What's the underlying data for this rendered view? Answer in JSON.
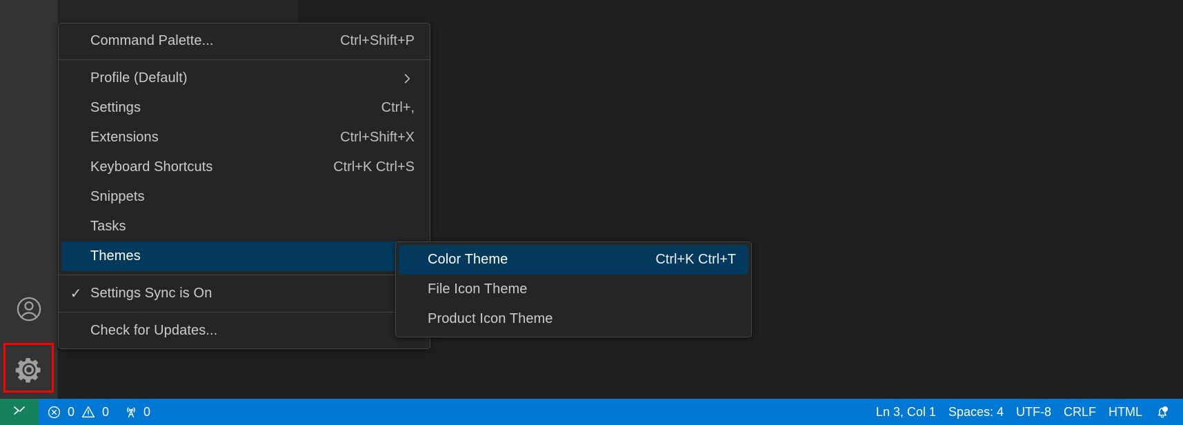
{
  "window": {
    "background_color": "#1f1f1f",
    "activity_bar_color": "#333333",
    "status_bar_color": "#0078d4",
    "menu_background_color": "#252526",
    "menu_selected_color": "#04395e",
    "focus_outline_color": "#ff0000",
    "remote_indicator_color": "#16825d"
  },
  "activity_bar": {
    "items": [
      {
        "name": "accounts",
        "icon": "account-icon",
        "title": "Accounts"
      },
      {
        "name": "manage",
        "icon": "gear-icon",
        "title": "Manage",
        "focused": true
      }
    ]
  },
  "gear_menu": {
    "groups": [
      {
        "items": [
          {
            "label": "Command Palette...",
            "keybinding": "Ctrl+Shift+P",
            "checked": false,
            "submenu": false,
            "selected": false
          }
        ]
      },
      {
        "items": [
          {
            "label": "Profile (Default)",
            "keybinding": "",
            "checked": false,
            "submenu": true,
            "selected": false
          },
          {
            "label": "Settings",
            "keybinding": "Ctrl+,",
            "checked": false,
            "submenu": false,
            "selected": false
          },
          {
            "label": "Extensions",
            "keybinding": "Ctrl+Shift+X",
            "checked": false,
            "submenu": false,
            "selected": false
          },
          {
            "label": "Keyboard Shortcuts",
            "keybinding": "Ctrl+K Ctrl+S",
            "checked": false,
            "submenu": false,
            "selected": false
          },
          {
            "label": "Snippets",
            "keybinding": "",
            "checked": false,
            "submenu": false,
            "selected": false
          },
          {
            "label": "Tasks",
            "keybinding": "",
            "checked": false,
            "submenu": false,
            "selected": false
          },
          {
            "label": "Themes",
            "keybinding": "",
            "checked": false,
            "submenu": true,
            "selected": true
          }
        ]
      },
      {
        "items": [
          {
            "label": "Settings Sync is On",
            "keybinding": "",
            "checked": true,
            "submenu": false,
            "selected": false
          }
        ]
      },
      {
        "items": [
          {
            "label": "Check for Updates...",
            "keybinding": "",
            "checked": false,
            "submenu": false,
            "selected": false
          }
        ]
      }
    ]
  },
  "themes_submenu": {
    "items": [
      {
        "label": "Color Theme",
        "keybinding": "Ctrl+K Ctrl+T",
        "selected": true
      },
      {
        "label": "File Icon Theme",
        "keybinding": "",
        "selected": false
      },
      {
        "label": "Product Icon Theme",
        "keybinding": "",
        "selected": false
      }
    ]
  },
  "status_bar": {
    "remote": {
      "icon": "remote-indicator-icon",
      "label": ""
    },
    "left": [
      {
        "name": "problems",
        "errors_icon": "error-circle-icon",
        "errors": "0",
        "warnings_icon": "warning-triangle-icon",
        "warnings": "0"
      },
      {
        "name": "ports",
        "icon": "radio-tower-icon",
        "value": "0"
      }
    ],
    "right": [
      {
        "name": "editor-position",
        "label": "Ln 3, Col 1"
      },
      {
        "name": "editor-indentation",
        "label": "Spaces: 4"
      },
      {
        "name": "editor-encoding",
        "label": "UTF-8"
      },
      {
        "name": "editor-eol",
        "label": "CRLF"
      },
      {
        "name": "editor-language",
        "label": "HTML"
      },
      {
        "name": "notifications",
        "icon": "bell-dot-icon",
        "label": ""
      }
    ]
  }
}
